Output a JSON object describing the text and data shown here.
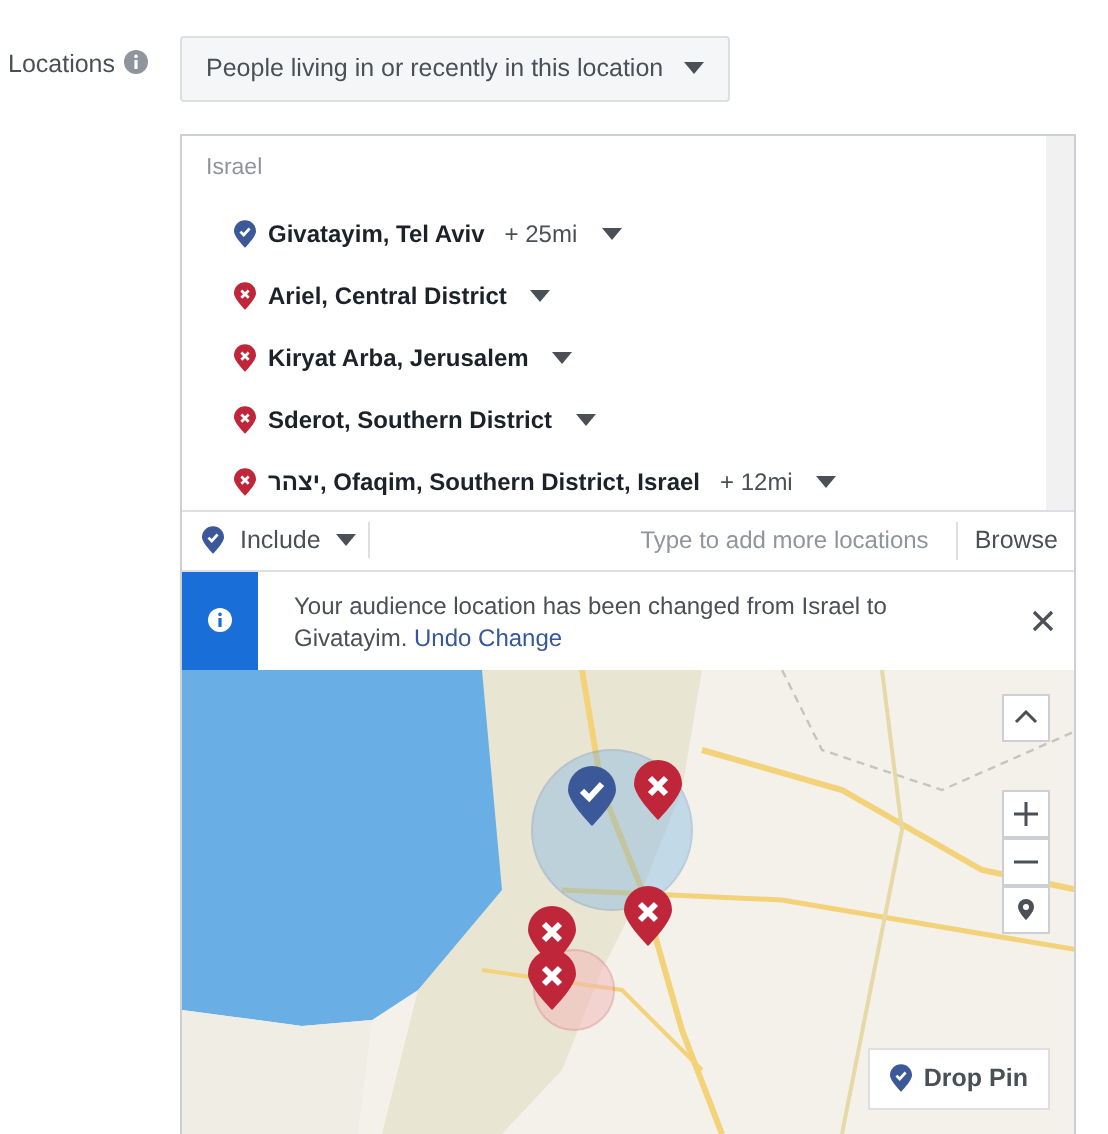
{
  "label": "Locations",
  "audience_dropdown": {
    "value": "People living in or recently in this location"
  },
  "country": "Israel",
  "locations": [
    {
      "name": "Givatayim, Tel Aviv",
      "kind": "include",
      "radius": "+ 25mi"
    },
    {
      "name": "Ariel, Central District",
      "kind": "exclude"
    },
    {
      "name": "Kiryat Arba, Jerusalem",
      "kind": "exclude"
    },
    {
      "name": "Sderot, Southern District",
      "kind": "exclude"
    },
    {
      "name": "יצהר, Ofaqim, Southern District, Israel",
      "kind": "exclude",
      "radius": "+ 12mi"
    }
  ],
  "include_dropdown": {
    "value": "Include",
    "kind": "include"
  },
  "search": {
    "placeholder": "Type to add more locations"
  },
  "browse": "Browse",
  "notice": {
    "text": "Your audience location has been changed from Israel to Givatayim.",
    "link": "Undo Change"
  },
  "map": {
    "kind": "picture",
    "drop_pin": "Drop Pin"
  }
}
